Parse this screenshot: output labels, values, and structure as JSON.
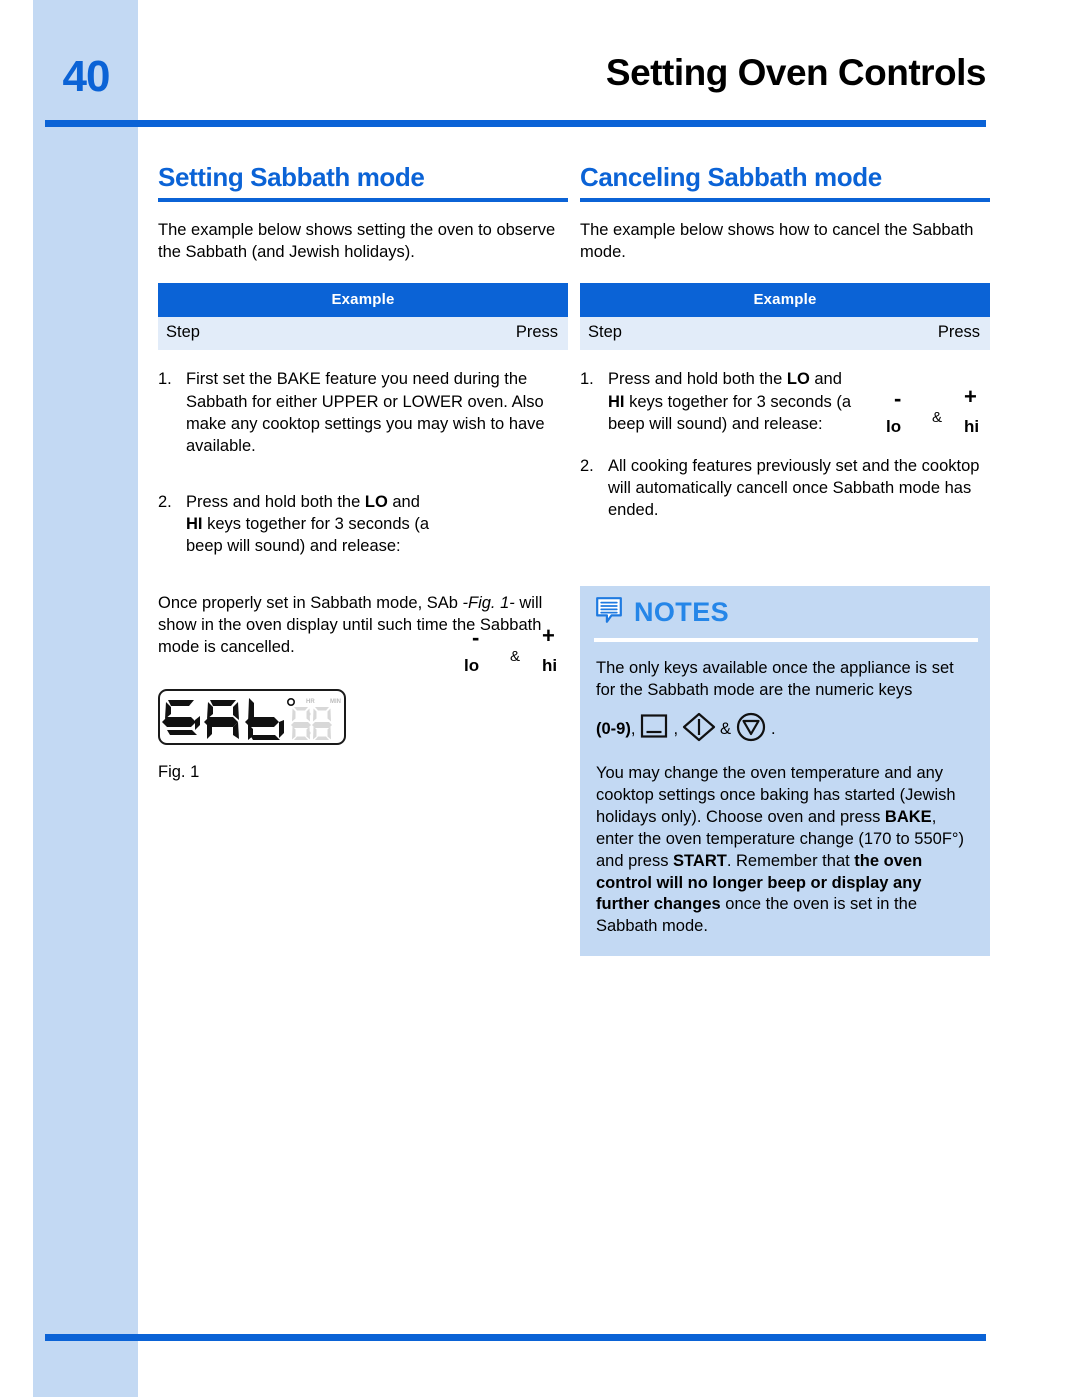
{
  "page": {
    "number": "40",
    "header_title": "Setting Oven Controls",
    "accent_color": "#0b63d6",
    "sidebar_color": "#c3d9f3"
  },
  "left_column": {
    "title": "Setting Sabbath mode",
    "intro": "The example below shows setting the oven to observe the Sabbath (and Jewish holidays).",
    "example_table": {
      "header": "Example",
      "col_step": "Step",
      "col_press": "Press"
    },
    "steps": [
      {
        "num": "1.",
        "text_parts": [
          {
            "t": "First set the BAKE feature you need during the Sabbath for either UPPER or LOWER oven. Also make any cooktop settings you may wish to have available.",
            "bold": false
          }
        ]
      },
      {
        "num": "2.",
        "text_parts": [
          {
            "t": "Press and hold both the ",
            "bold": false
          },
          {
            "t": "LO",
            "bold": true
          },
          {
            "t": " and ",
            "bold": false
          },
          {
            "t": "HI",
            "bold": true
          },
          {
            "t": " keys together for 3 seconds (a beep will sound) and release:",
            "bold": false
          }
        ]
      }
    ],
    "key_art": {
      "minus": "-",
      "lo": "lo",
      "amp": "&",
      "plus": "+",
      "hi": "hi"
    },
    "closing_parts": [
      {
        "t": "Once properly set in Sabbath mode, SAb ",
        "style": "normal"
      },
      {
        "t": "-Fig. 1-",
        "style": "italic"
      },
      {
        "t": " will show in the oven display until such time the Sabbath mode is cancelled.",
        "style": "normal"
      }
    ],
    "figure": {
      "display_text": "SAb",
      "degree_symbol": "°",
      "hr_label": "HR",
      "min_label": "MIN",
      "clock_digits": "88:88",
      "caption": "Fig. 1"
    }
  },
  "right_column": {
    "title": "Canceling Sabbath mode",
    "intro": "The example below shows how to cancel the Sabbath mode.",
    "example_table": {
      "header": "Example",
      "col_step": "Step",
      "col_press": "Press"
    },
    "steps": [
      {
        "num": "1.",
        "text_parts": [
          {
            "t": "Press and hold both the ",
            "bold": false
          },
          {
            "t": "LO",
            "bold": true
          },
          {
            "t": " and ",
            "bold": false
          },
          {
            "t": "HI",
            "bold": true
          },
          {
            "t": " keys together for 3 seconds (a beep will sound) and release:",
            "bold": false
          }
        ]
      },
      {
        "num": "2.",
        "text_parts": [
          {
            "t": "All cooking features previously set and the cooktop will automatically cancell once Sabbath mode has ended.",
            "bold": false
          }
        ]
      }
    ],
    "key_art": {
      "minus": "-",
      "lo": "lo",
      "amp": "&",
      "plus": "+",
      "hi": "hi"
    }
  },
  "notes": {
    "icon": "notes-bubble-icon",
    "title": "NOTES",
    "paragraph_1": "The only keys available once the appliance is set for the Sabbath mode are the numeric keys",
    "key_line": {
      "prefix_bold": "(0-9)",
      "prefix_tail": ",",
      "icon_1": "clear-off-key-icon",
      "sep_1": ",",
      "icon_2": "start-key-icon",
      "sep_2": "&",
      "icon_3": "stop-cancel-key-icon",
      "suffix": "."
    },
    "paragraph_2_parts": [
      {
        "t": "You may change the oven temperature and any cooktop settings once baking has started (Jewish holidays only). Choose oven and press ",
        "bold": false
      },
      {
        "t": "BAKE",
        "bold": true
      },
      {
        "t": ", enter the oven temperature change (170 to 550F°) and press ",
        "bold": false
      },
      {
        "t": "START",
        "bold": true
      },
      {
        "t": ". Remember that ",
        "bold": false
      },
      {
        "t": "the oven control will no longer beep or display any further changes",
        "bold": true
      },
      {
        "t": " once the oven is set in the Sabbath mode.",
        "bold": false
      }
    ]
  }
}
